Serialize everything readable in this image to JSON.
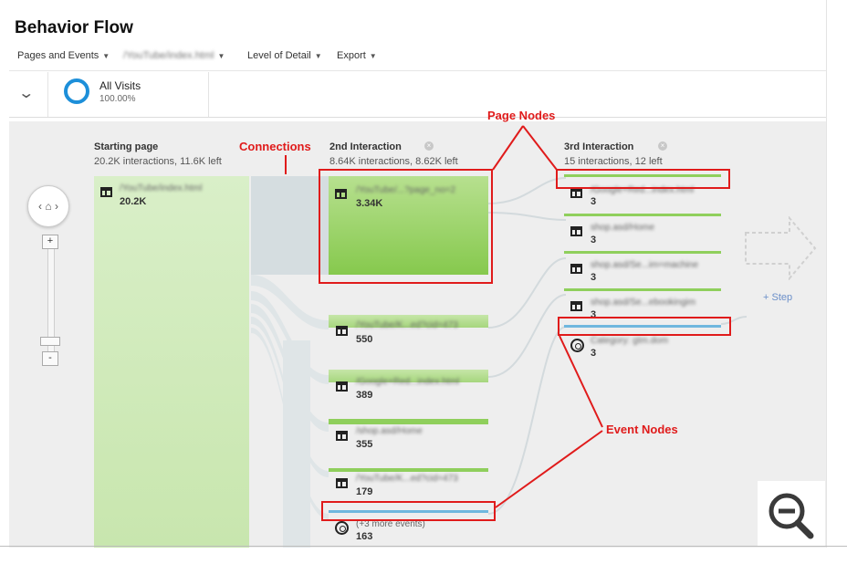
{
  "page": {
    "title": "Behavior Flow"
  },
  "toolbar": {
    "items": [
      {
        "label": "Pages and Events"
      },
      {
        "label": "/YouTube/index.html"
      },
      {
        "label": "Level of Detail"
      },
      {
        "label": "Export"
      }
    ]
  },
  "segment": {
    "name": "All Visits",
    "percent": "100.00%"
  },
  "columns": [
    {
      "title": "Starting page",
      "stats": "20.2K interactions, 11.6K left"
    },
    {
      "title": "2nd Interaction",
      "stats": "8.64K interactions, 8.62K left"
    },
    {
      "title": "3rd Interaction",
      "stats": "15 interactions, 12 left"
    }
  ],
  "starting_node": {
    "label": "/YouTube/index.html",
    "value": "20.2K"
  },
  "second_nodes": [
    {
      "label": "/YouTube/...?page_no=2",
      "value": "3.34K"
    },
    {
      "label": "/YouTube/K...ed?cid=473",
      "value": "550"
    },
    {
      "label": "/Google+Red...index.html",
      "value": "389"
    },
    {
      "label": "/shop.asd/Home",
      "value": "355"
    },
    {
      "label": "/YouTube/K...ed?cid=473",
      "value": "179"
    },
    {
      "label": "(+3 more events)",
      "value": "163"
    }
  ],
  "third_nodes": [
    {
      "label": "/Google+Red...index.html",
      "value": "3"
    },
    {
      "label": "shop.asd/Home",
      "value": "3"
    },
    {
      "label": "shop.asd/Se...im=machine",
      "value": "3"
    },
    {
      "label": "shop.asd/Se...ebookingim",
      "value": "3"
    },
    {
      "label": "Category: gtm.dom",
      "value": "3"
    }
  ],
  "add_step": "+ Step",
  "annotations": {
    "page_nodes": "Page Nodes",
    "connections": "Connections",
    "event_nodes": "Event Nodes"
  },
  "colors": {
    "annotation_red": "#e01b1b",
    "node_green": "#8fcf5c",
    "event_blue": "#6fb7de",
    "segment_ring": "#1d8fd9"
  },
  "icons": {
    "collapse": "chevron-down-icon",
    "home": "home-icon",
    "page": "page-node-icon",
    "event": "event-node-icon",
    "zoom_out": "magnifier-minus-icon"
  }
}
